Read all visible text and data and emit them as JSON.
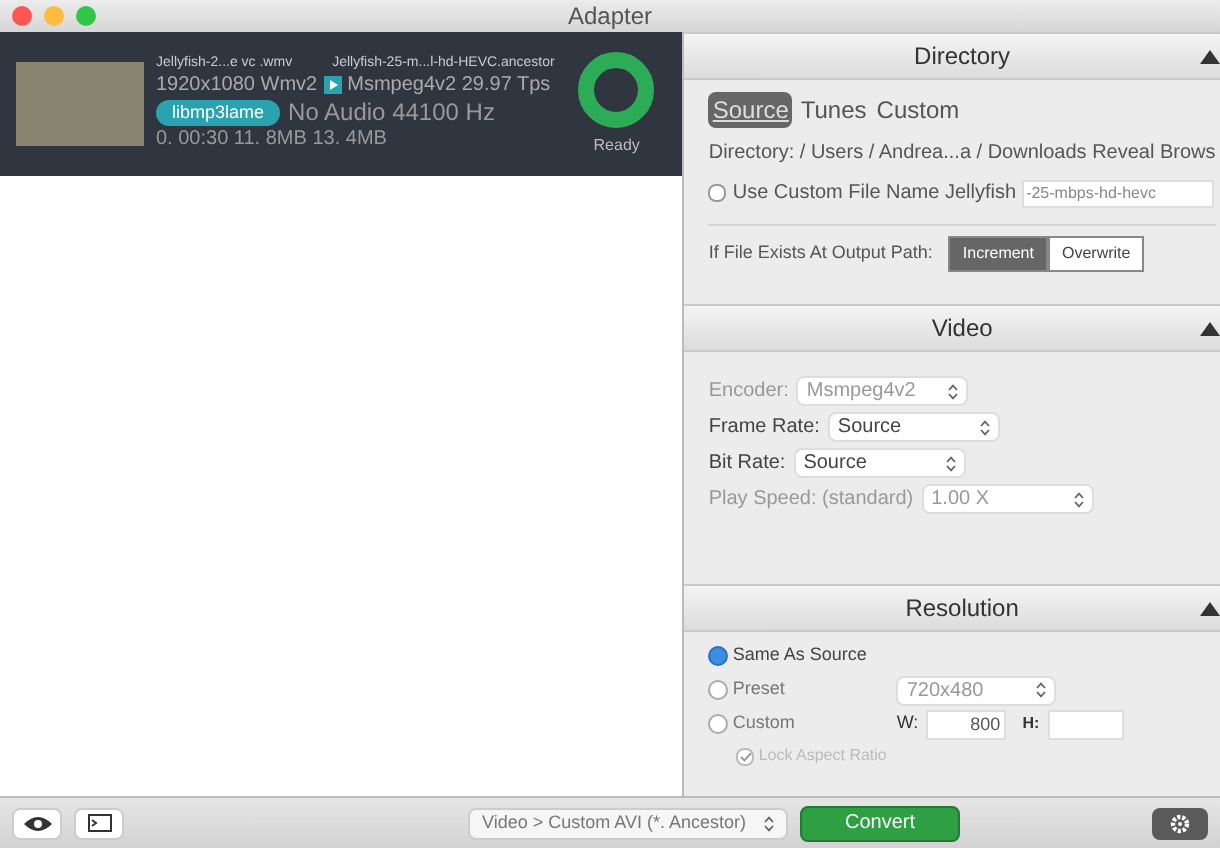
{
  "window": {
    "title": "Adapter"
  },
  "file": {
    "source_name": "Jellyfish-2...e vc .wmv",
    "output_name": "Jellyfish-25-m...l-hd-HEVC.ancestor",
    "video_info": "1920x1080 Wmv2",
    "video_output": "Msmpeg4v2 29.97 Tps",
    "audio_codec": "libmp3lame",
    "audio_output": "No Audio 44100 Hz",
    "size_info": "0. 00:30 11. 8MB 13. 4MB",
    "status": "Ready",
    "level": 1
  },
  "directory": {
    "title": "Directory",
    "modes": [
      {
        "label": "Source",
        "selected": true
      },
      {
        "label": "Tunes",
        "selected": false
      },
      {
        "label": "Custom",
        "selected": false
      }
    ],
    "path": "Directory: / Users / Andrea...a / Downloads Reveal Brows",
    "custom_name": {
      "label": "Use Custom File Name Jellyfish",
      "checked": false,
      "value": "-25-mbps-hd-hevc"
    },
    "exists_label": "If File Exists At Output Path:",
    "exists_options": [
      {
        "label": "Increment",
        "selected": true
      },
      {
        "label": "Overwrite",
        "selected": false
      }
    ]
  },
  "video": {
    "title": "Video",
    "rows": [
      {
        "label": "Encoder:",
        "value": "Msmpeg4v2",
        "disabled": true
      },
      {
        "label": "Frame Rate:",
        "value": "Source",
        "disabled": false
      },
      {
        "label": "Bit Rate:",
        "value": "Source",
        "disabled": false
      },
      {
        "label": "Play Speed: (standard)",
        "value": "1.00 X",
        "disabled": true
      }
    ]
  },
  "resolution": {
    "title": "Resolution",
    "options": [
      {
        "label": "Same As Source",
        "selected": true
      },
      {
        "label": "Preset",
        "selected": false
      },
      {
        "label": "Custom",
        "selected": false
      }
    ],
    "preset_value": "720x480",
    "width_label": "W:",
    "width_value": "800",
    "height_label": "H:",
    "lock_aspect": {
      "label": "Lock Aspect Ratio",
      "checked": true
    }
  },
  "bottom_bar": {
    "preset": "Video > Custom AVI (*. Ancestor)",
    "convert": "Convert"
  }
}
